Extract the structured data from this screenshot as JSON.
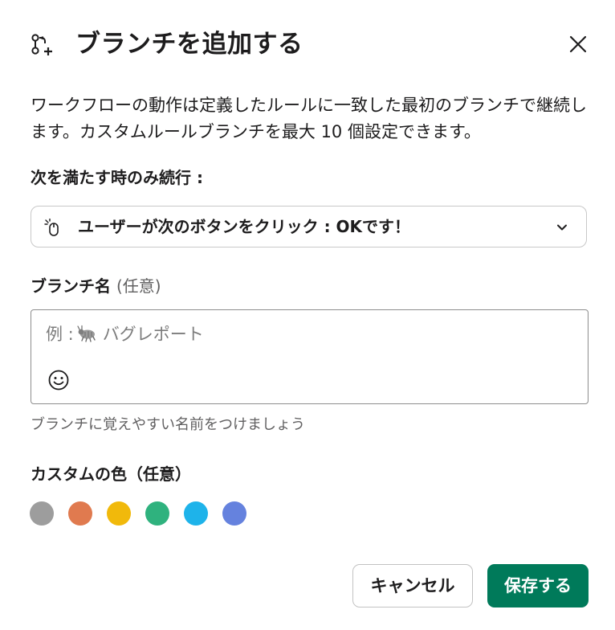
{
  "dialog": {
    "title": "ブランチを追加する",
    "description": "ワークフローの動作は定義したルールに一致した最初のブランチで継続します。カスタムルールブランチを最大 10 個設定できます。"
  },
  "condition": {
    "label": "次を満たす時のみ続行 :",
    "selected_value": "ユーザーが次のボタンをクリック : OKです！",
    "icon": "mouse-click-icon"
  },
  "branch_name": {
    "label": "ブランチ名",
    "optional": "(任意)",
    "placeholder_prefix": "例 :",
    "placeholder_text": "バグレポート",
    "placeholder_icon": "bug-icon",
    "hint": "ブランチに覚えやすい名前をつけましょう"
  },
  "custom_color": {
    "label": "カスタムの色",
    "optional": "（任意）",
    "colors": [
      "#9d9d9d",
      "#e07a4f",
      "#f1b90b",
      "#2fb27e",
      "#1eb3ea",
      "#6582de"
    ]
  },
  "buttons": {
    "cancel": "キャンセル",
    "save": "保存する"
  },
  "colors": {
    "primary": "#007a5a",
    "text": "#1d1c1d",
    "muted": "#616061"
  }
}
